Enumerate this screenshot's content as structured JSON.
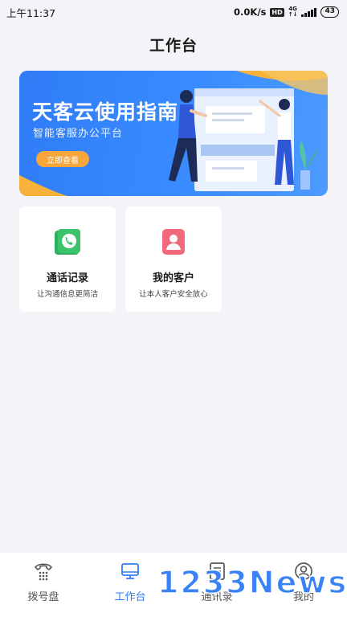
{
  "status_bar": {
    "time": "上午11:37",
    "network_speed": "0.0K/s",
    "hd_label": "HD",
    "network_type": "4G",
    "battery": "43"
  },
  "page": {
    "title": "工作台"
  },
  "banner": {
    "title": "天客云使用指南",
    "subtitle": "智能客服办公平台",
    "button_label": "立即查看"
  },
  "cards": [
    {
      "title": "通话记录",
      "desc": "让沟通信息更简洁",
      "icon": "phone-record-icon",
      "color": "#3bc46b"
    },
    {
      "title": "我的客户",
      "desc": "让本人客户安全放心",
      "icon": "customer-icon",
      "color": "#f06a7b"
    }
  ],
  "bottom_nav": {
    "items": [
      {
        "label": "拨号盘",
        "icon": "dialpad-icon"
      },
      {
        "label": "工作台",
        "icon": "desktop-icon",
        "active": true
      },
      {
        "label": "通讯录",
        "icon": "contacts-icon"
      },
      {
        "label": "我的",
        "icon": "user-icon"
      }
    ]
  },
  "watermark": {
    "text": "1233News"
  },
  "colors": {
    "accent": "#2f7cf6",
    "banner_button": "#f6a63a"
  }
}
